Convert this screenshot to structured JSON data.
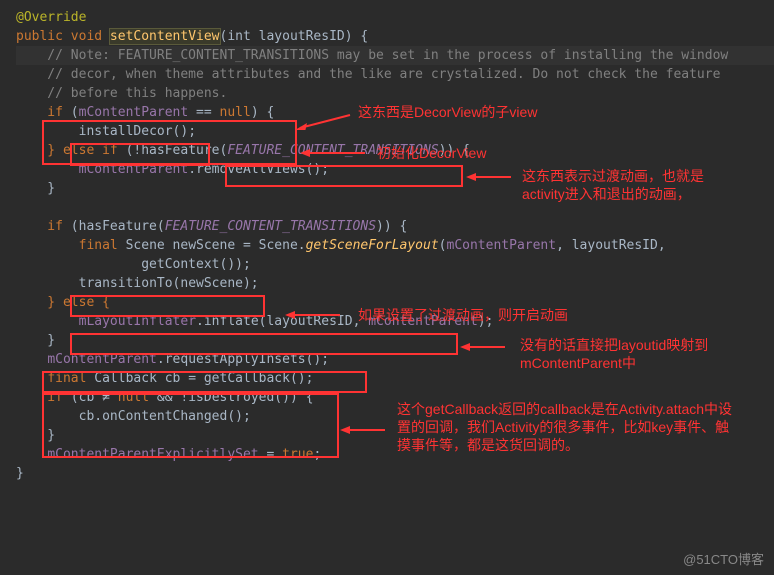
{
  "code": {
    "l1_anno": "@Override",
    "l2_mods": "public void ",
    "l2_method": "setContentView",
    "l2_params": "(int layoutResID) {",
    "l3": "    // Note: FEATURE_CONTENT_TRANSITIONS may be set in the process of installing the window",
    "l4": "    // decor, when theme attributes and the like are crystalized. Do not check the feature",
    "l5": "    // before this happens.",
    "l6_if": "    if",
    "l6_cond_a": " (",
    "l6_field": "mContentParent",
    "l6_eq": " == ",
    "l6_null": "null",
    "l6_close": ") {",
    "l7_pad": "        ",
    "l7_call": "installDecor();",
    "l8_else": "    } else if",
    "l8_a": " (!hasFeature(",
    "l8_const": "FEATURE_CONTENT_TRANSITIONS",
    "l8_b": ")) {",
    "l9_pad": "        ",
    "l9_field": "mContentParent",
    "l9_call": ".removeAllViews();",
    "l10": "    }",
    "l12_if": "    if",
    "l12_a": " (hasFeature(",
    "l12_const": "FEATURE_CONTENT_TRANSITIONS",
    "l12_b": ")) {",
    "l13_pad": "        ",
    "l13_final": "final",
    "l13_a": " Scene newScene = Scene.",
    "l13_m": "getSceneForLayout",
    "l13_b": "(",
    "l13_f": "mContentParent",
    "l13_c": ", layoutResID,",
    "l14": "                getContext());",
    "l15_pad": "        ",
    "l15_call": "transitionTo(newScene);",
    "l16_else": "    } else {",
    "l17_pad": "        ",
    "l17_field": "mLayoutInflater",
    "l17_a": ".inflate(layoutResID, ",
    "l17_field2": "mContentParent",
    "l17_b": ");",
    "l18": "    }",
    "l19_pad": "    ",
    "l19_field": "mContentParent",
    "l19_call": ".requestApplyInsets();",
    "l20_pad": "    ",
    "l20_final": "final",
    "l20_a": " Callback cb = getCallback();",
    "l21_if": "    if",
    "l21_a": " (cb ≠ ",
    "l21_null": "null",
    "l21_b": " && !isDestroyed()) {",
    "l22": "        cb.onContentChanged();",
    "l23": "    }",
    "l24_pad": "    ",
    "l24_field": "mContentParentExplicitlySet",
    "l24_a": " = ",
    "l24_true": "true",
    "l24_b": ";",
    "l25": "}"
  },
  "annotations": {
    "a1": "这东西是DecorView的子view",
    "a2": "初始化DecorView",
    "a3": "这东西表示过渡动画，也就是activity进入和退出的动画，",
    "a4": "如果设置了过渡动画，则开启动画",
    "a5": "没有的话直接把layoutid映射到mContentParent中",
    "a6": "这个getCallback返回的callback是在Activity.attach中设置的回调，我们Activity的很多事件，比如key事件、触摸事件等，都是这货回调的。"
  },
  "watermark": "@51CTO博客"
}
